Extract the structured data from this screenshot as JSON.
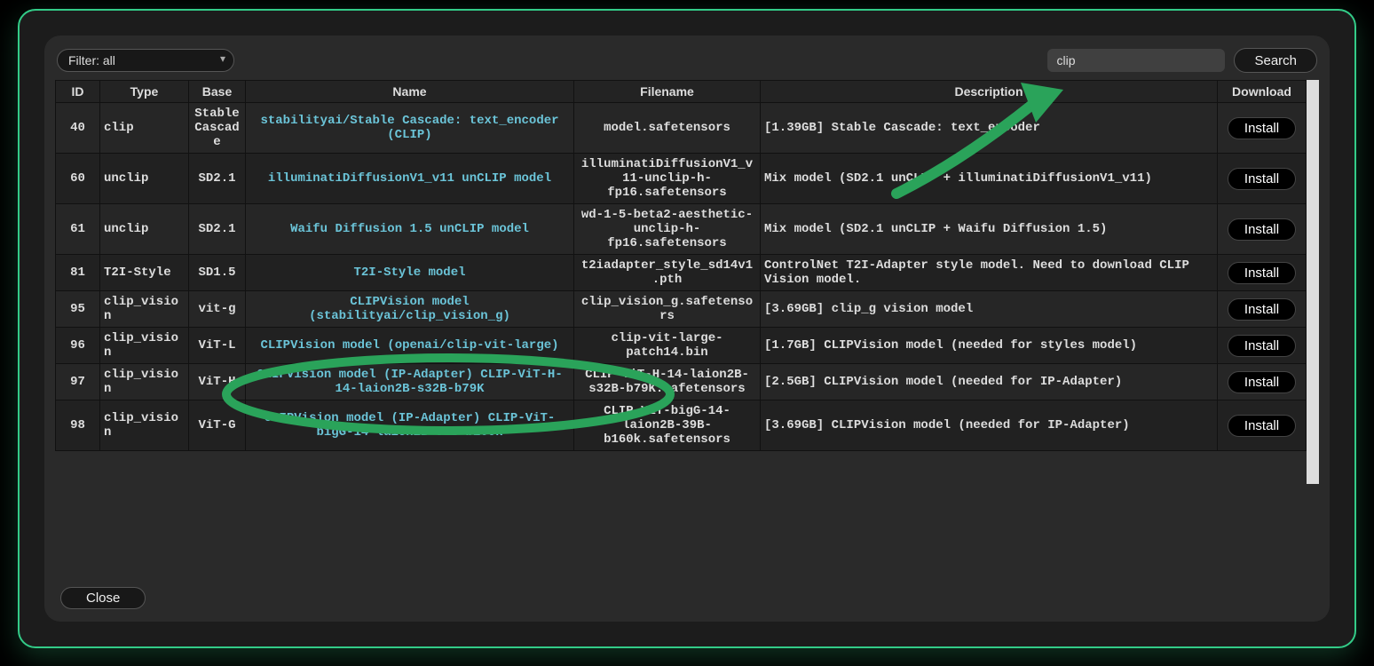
{
  "toolbar": {
    "filter_label": "Filter: all",
    "search_value": "clip",
    "search_btn": "Search"
  },
  "headers": {
    "id": "ID",
    "type": "Type",
    "base": "Base",
    "name": "Name",
    "filename": "Filename",
    "description": "Description",
    "download": "Download"
  },
  "rows": [
    {
      "id": "40",
      "type": "clip",
      "base": "Stable Cascade",
      "name": "stabilityai/Stable Cascade: text_encoder (CLIP)",
      "filename": "model.safetensors",
      "desc": "[1.39GB] Stable Cascade: text_encoder",
      "btn": "Install"
    },
    {
      "id": "60",
      "type": "unclip",
      "base": "SD2.1",
      "name": "illuminatiDiffusionV1_v11 unCLIP model",
      "filename": "illuminatiDiffusionV1_v11-unclip-h-fp16.safetensors",
      "desc": "Mix model (SD2.1 unCLIP + illuminatiDiffusionV1_v11)",
      "btn": "Install"
    },
    {
      "id": "61",
      "type": "unclip",
      "base": "SD2.1",
      "name": "Waifu Diffusion 1.5 unCLIP model",
      "filename": "wd-1-5-beta2-aesthetic-unclip-h-fp16.safetensors",
      "desc": "Mix model (SD2.1 unCLIP + Waifu Diffusion 1.5)",
      "btn": "Install"
    },
    {
      "id": "81",
      "type": "T2I-Style",
      "base": "SD1.5",
      "name": "T2I-Style model",
      "filename": "t2iadapter_style_sd14v1.pth",
      "desc": "ControlNet T2I-Adapter style model. Need to download CLIP Vision model.",
      "btn": "Install"
    },
    {
      "id": "95",
      "type": "clip_vision",
      "base": "vit-g",
      "name": "CLIPVision model (stabilityai/clip_vision_g)",
      "filename": "clip_vision_g.safetensors",
      "desc": "[3.69GB] clip_g vision model",
      "btn": "Install"
    },
    {
      "id": "96",
      "type": "clip_vision",
      "base": "ViT-L",
      "name": "CLIPVision model (openai/clip-vit-large)",
      "filename": "clip-vit-large-patch14.bin",
      "desc": "[1.7GB] CLIPVision model (needed for styles model)",
      "btn": "Install"
    },
    {
      "id": "97",
      "type": "clip_vision",
      "base": "ViT-H",
      "name": "CLIPVision model (IP-Adapter) CLIP-ViT-H-14-laion2B-s32B-b79K",
      "filename": "CLIP-ViT-H-14-laion2B-s32B-b79K.safetensors",
      "desc": "[2.5GB] CLIPVision model (needed for IP-Adapter)",
      "btn": "Install"
    },
    {
      "id": "98",
      "type": "clip_vision",
      "base": "ViT-G",
      "name": "CLIPVision model (IP-Adapter) CLIP-ViT-bigG-14-laion2B-39B-b160k",
      "filename": "CLIP-ViT-bigG-14-laion2B-39B-b160k.safetensors",
      "desc": "[3.69GB] CLIPVision model (needed for IP-Adapter)",
      "btn": "Install"
    }
  ],
  "footer": {
    "close": "Close"
  }
}
